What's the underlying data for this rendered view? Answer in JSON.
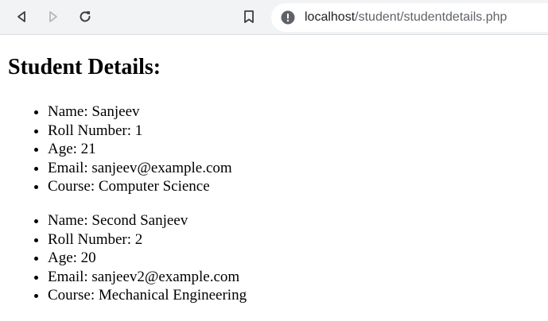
{
  "browser": {
    "url_host": "localhost",
    "url_path": "/student/studentdetails.php"
  },
  "page": {
    "title": "Student Details:"
  },
  "students": [
    {
      "name": "Name: Sanjeev",
      "roll": "Roll Number: 1",
      "age": "Age: 21",
      "email": "Email: sanjeev@example.com",
      "course": "Course: Computer Science"
    },
    {
      "name": "Name: Second Sanjeev",
      "roll": "Roll Number: 2",
      "age": "Age: 20",
      "email": "Email: sanjeev2@example.com",
      "course": "Course: Mechanical Engineering"
    }
  ]
}
